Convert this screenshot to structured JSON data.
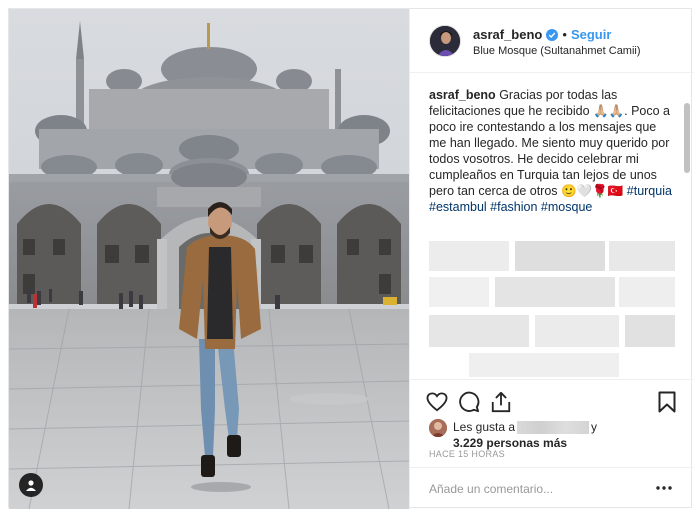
{
  "header": {
    "username": "asraf_beno",
    "separator": "•",
    "follow_label": "Seguir",
    "location": "Blue Mosque (Sultanahmet Camii)"
  },
  "caption": {
    "username": "asraf_beno",
    "text": "Gracias por todas las felicitaciones que he recibido 🙏🏼🙏🏼. Poco a poco ire contestando a los mensajes que me han llegado. Me siento muy querido por todos vosotros. He decido celebrar mi cumpleaños en Turquia tan lejos de unos pero tan cerca de otros 🙂🤍🌹🇹🇷",
    "hashtags": [
      "#turquia",
      "#estambul",
      "#fashion",
      "#mosque"
    ]
  },
  "likes": {
    "prefix": "Les gusta a",
    "suffix": "y",
    "count_text": "3.229 personas más"
  },
  "timestamp": "HACE 15 HORAS",
  "comment": {
    "placeholder": "Añade un comentario..."
  },
  "icons": {
    "verified": "verified-badge-icon",
    "like": "heart-icon",
    "comment": "comment-bubble-icon",
    "share": "share-icon",
    "save": "bookmark-icon",
    "more": "more-options-icon",
    "tag": "user-tag-icon"
  },
  "colors": {
    "link": "#3897f0",
    "hashtag": "#003569",
    "border": "#efefef",
    "muted": "#999999"
  }
}
